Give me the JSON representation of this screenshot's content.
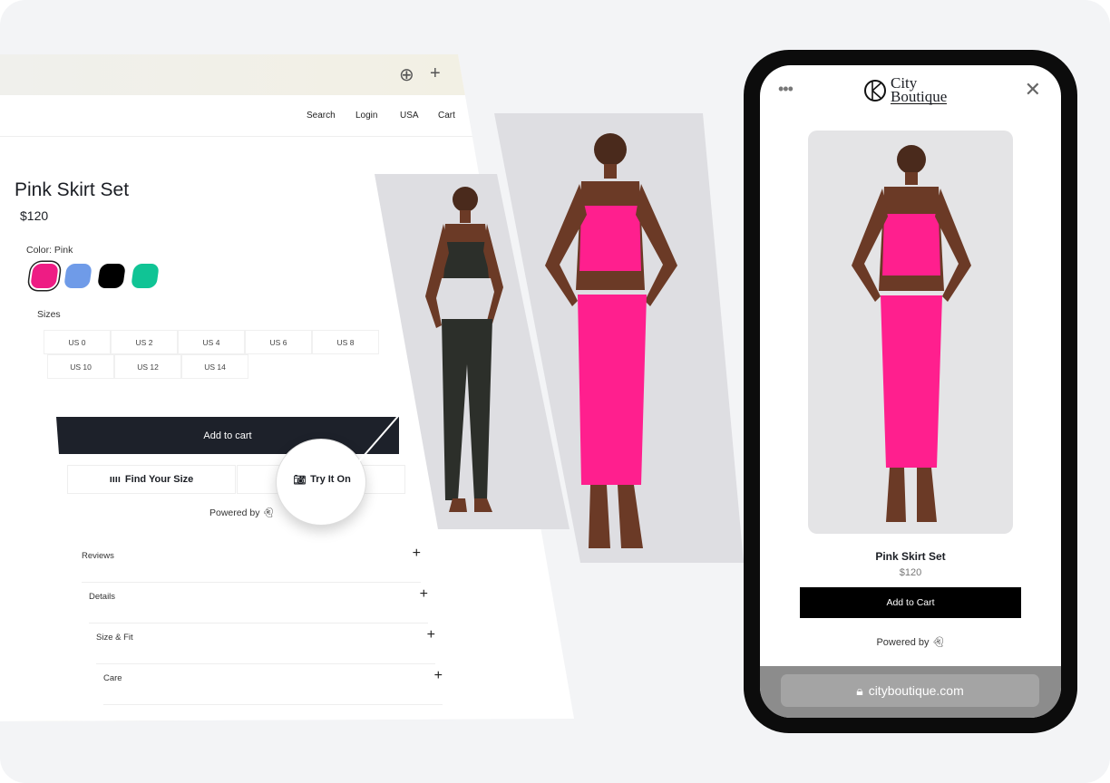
{
  "browser": {
    "icons": [
      "download-icon",
      "plus-icon"
    ],
    "nav": [
      "Search",
      "Login",
      "USA",
      "Cart"
    ],
    "product": {
      "title": "Pink Skirt Set",
      "price": "$120",
      "color_label": "Color: Pink",
      "swatches": [
        "#ee1c84",
        "#6f9be8",
        "#000000",
        "#10c495"
      ],
      "sizes_label": "Sizes",
      "sizes": [
        "US 0",
        "US 2",
        "US 4",
        "US 6",
        "US 8",
        "US 10",
        "US 12",
        "US 14"
      ],
      "add_to_cart": "Add to cart",
      "find_size": "Find Your Size",
      "try_on": "Try It On",
      "powered_by": "Powered by"
    },
    "accordion": [
      "Reviews",
      "Details",
      "Size & Fit",
      "Care"
    ]
  },
  "phone": {
    "brand_line1": "City",
    "brand_line2": "Boutique",
    "title": "Pink Skirt Set",
    "price": "$120",
    "add_to_cart": "Add to Cart",
    "powered_by": "Powered by",
    "url": "cityboutique.com"
  },
  "colors": {
    "accent_pink": "#ff1f8e",
    "dark_button": "#1d212a"
  }
}
